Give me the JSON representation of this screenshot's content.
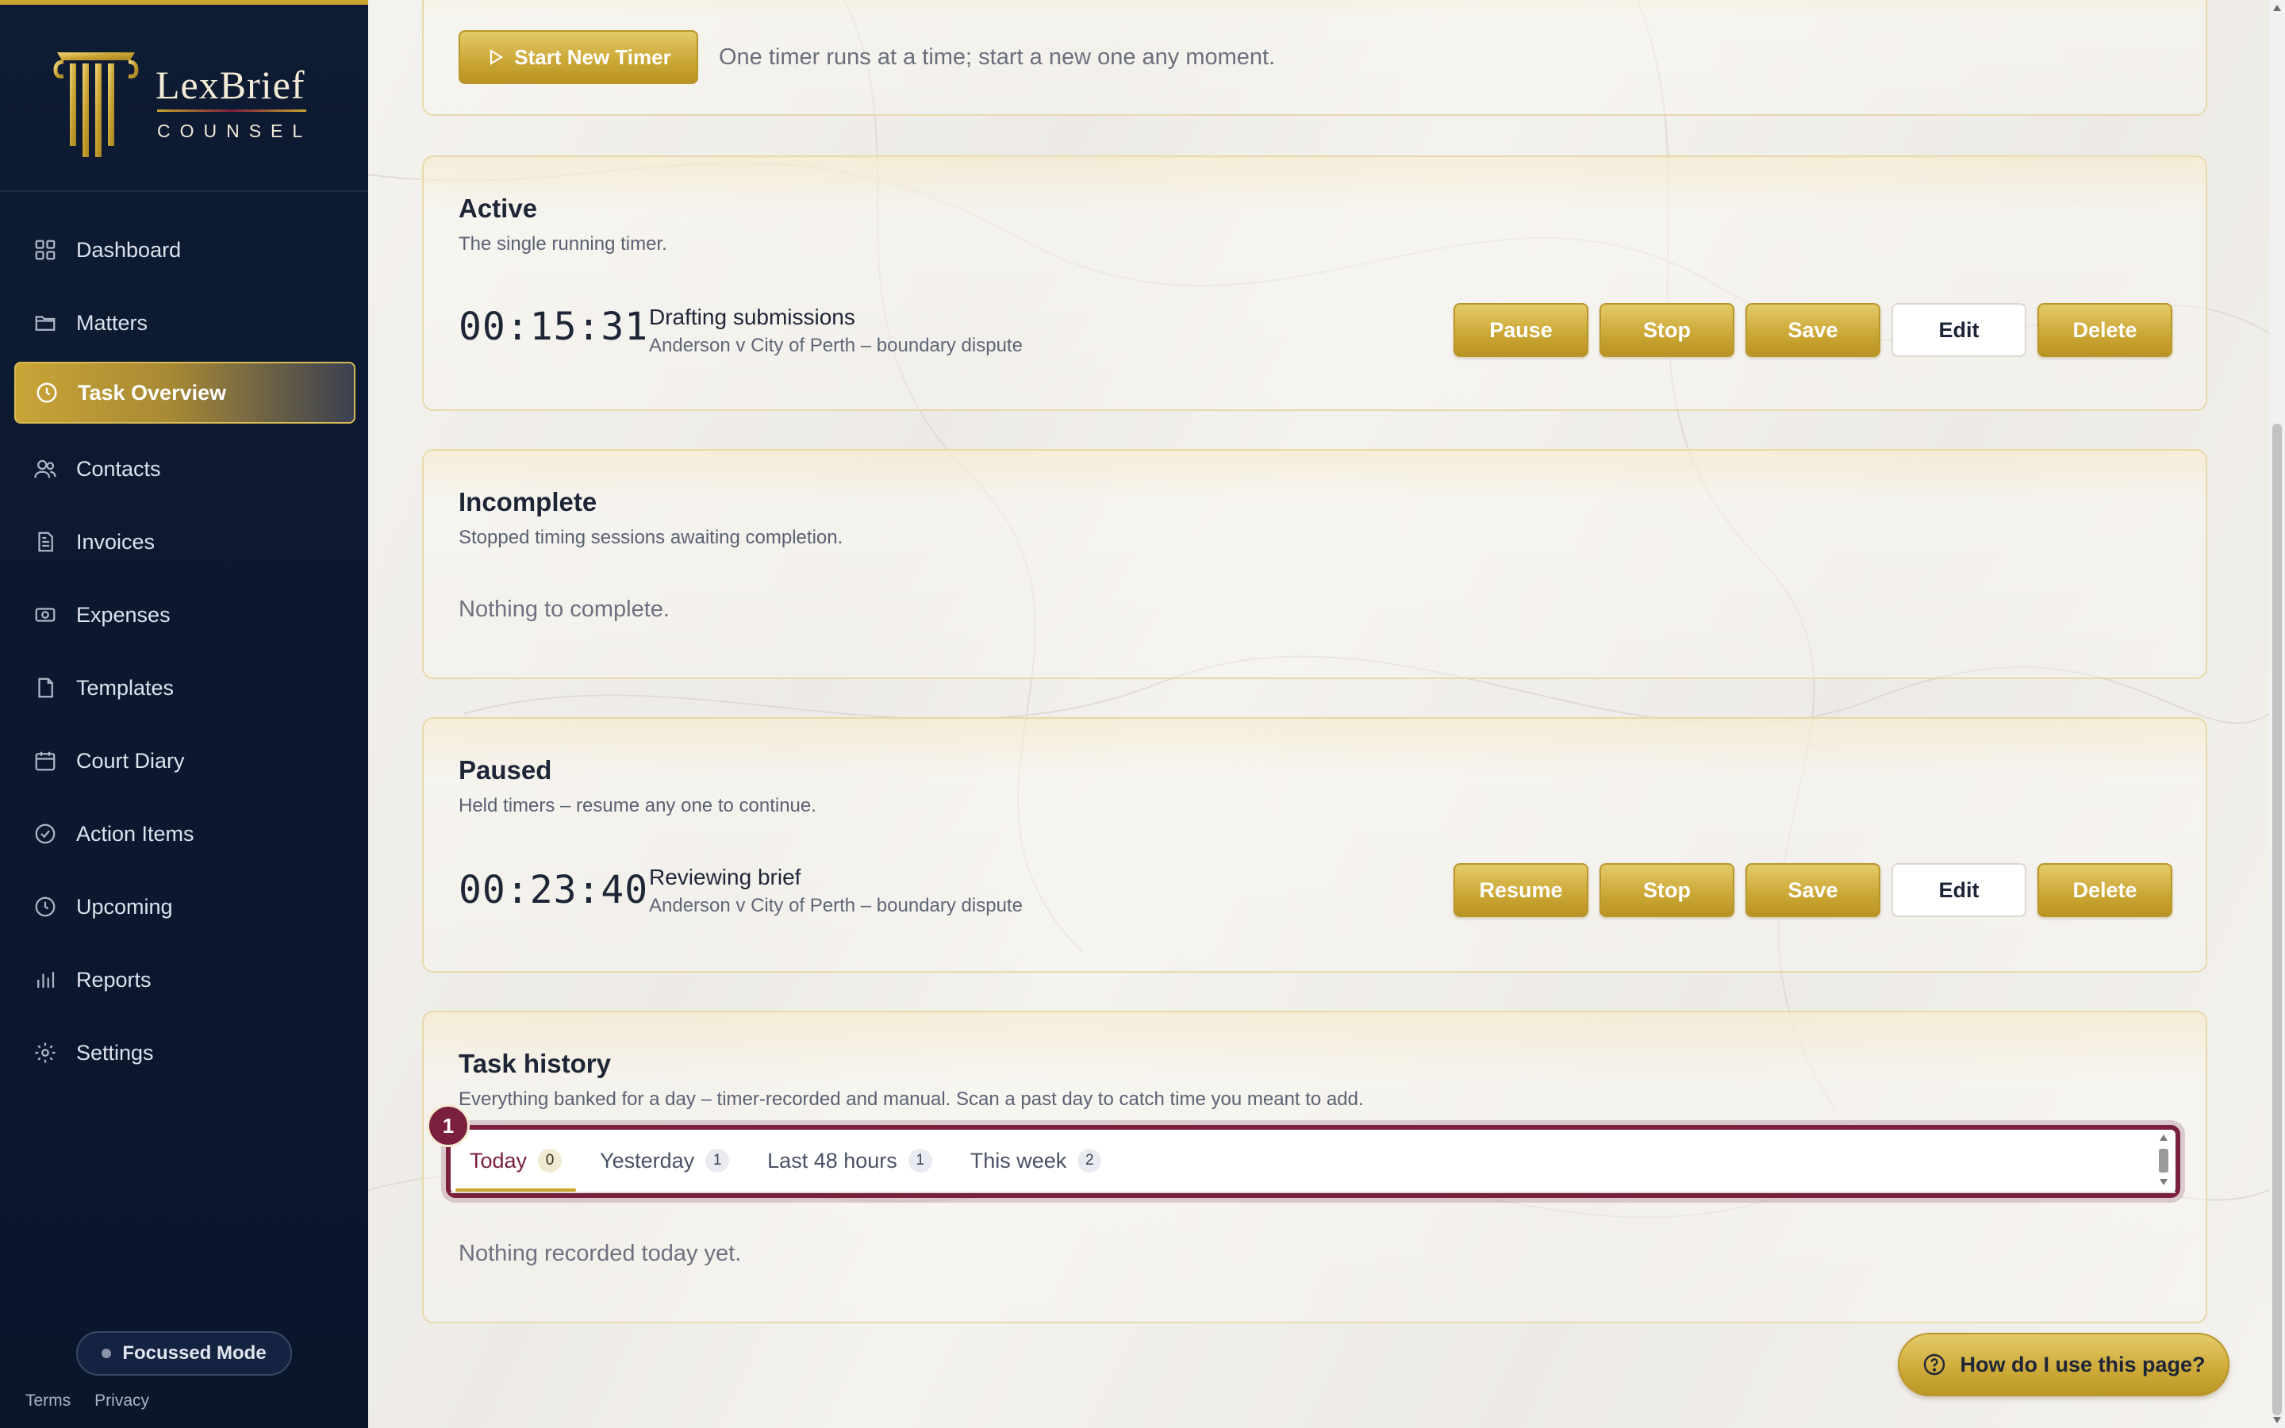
{
  "brand": {
    "name": "LexBrief",
    "subtitle": "COUNSEL",
    "colors": {
      "navy": "#0d1b33",
      "gold": "#c9a52e",
      "burgundy": "#7a1f3d"
    }
  },
  "sidebar": {
    "items": [
      {
        "label": "Dashboard",
        "icon": "grid-icon"
      },
      {
        "label": "Matters",
        "icon": "folder-icon"
      },
      {
        "label": "Task Overview",
        "icon": "clock-icon",
        "active": true
      },
      {
        "label": "Contacts",
        "icon": "users-icon"
      },
      {
        "label": "Invoices",
        "icon": "invoice-icon"
      },
      {
        "label": "Expenses",
        "icon": "banknote-icon"
      },
      {
        "label": "Templates",
        "icon": "file-icon"
      },
      {
        "label": "Court Diary",
        "icon": "calendar-icon"
      },
      {
        "label": "Action Items",
        "icon": "check-circle-icon"
      },
      {
        "label": "Upcoming",
        "icon": "clock-icon"
      },
      {
        "label": "Reports",
        "icon": "bar-chart-icon"
      },
      {
        "label": "Settings",
        "icon": "gear-icon"
      }
    ],
    "focus_mode": "Focussed Mode",
    "footer": {
      "terms": "Terms",
      "privacy": "Privacy"
    }
  },
  "timer_bar": {
    "start_label": "Start New Timer",
    "hint": "One timer runs at a time; start a new one any moment."
  },
  "active": {
    "title": "Active",
    "description": "The single running timer.",
    "entry": {
      "time": "00:15:31",
      "task": "Drafting submissions",
      "matter": "Anderson v City of Perth – boundary dispute"
    },
    "actions": {
      "pause": "Pause",
      "stop": "Stop",
      "save": "Save",
      "edit": "Edit",
      "delete": "Delete"
    }
  },
  "incomplete": {
    "title": "Incomplete",
    "description": "Stopped timing sessions awaiting completion.",
    "empty": "Nothing to complete."
  },
  "paused": {
    "title": "Paused",
    "description": "Held timers – resume any one to continue.",
    "entry": {
      "time": "00:23:40",
      "task": "Reviewing brief",
      "matter": "Anderson v City of Perth – boundary dispute"
    },
    "actions": {
      "resume": "Resume",
      "stop": "Stop",
      "save": "Save",
      "edit": "Edit",
      "delete": "Delete"
    }
  },
  "history": {
    "title": "Task history",
    "description": "Everything banked for a day – timer-recorded and manual. Scan a past day to catch time you meant to add.",
    "highlight_number": "1",
    "tabs": [
      {
        "label": "Today",
        "count": "0",
        "active": true
      },
      {
        "label": "Yesterday",
        "count": "1"
      },
      {
        "label": "Last 48 hours",
        "count": "1"
      },
      {
        "label": "This week",
        "count": "2"
      }
    ],
    "empty": "Nothing recorded today yet."
  },
  "help": {
    "label": "How do I use this page?"
  }
}
